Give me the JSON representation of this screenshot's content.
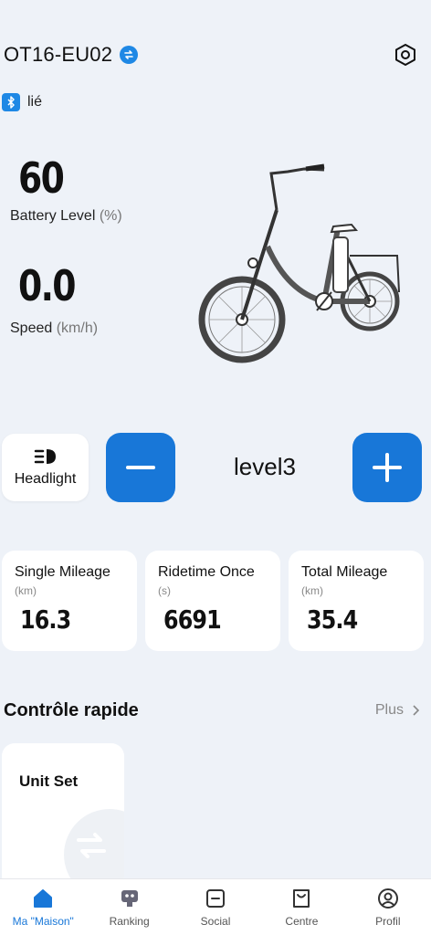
{
  "header": {
    "device_name": "OT16-EU02"
  },
  "bluetooth": {
    "status": "lié"
  },
  "battery": {
    "value": "60",
    "label": "Battery Level",
    "unit": "(%)"
  },
  "speed": {
    "value": "0.0",
    "label": "Speed",
    "unit": "(km/h)"
  },
  "controls": {
    "headlight_label": "Headlight",
    "level": "level3"
  },
  "metrics": [
    {
      "title": "Single Mileage",
      "unit": "(km)",
      "value": "16.3"
    },
    {
      "title": "Ridetime Once",
      "unit": "(s)",
      "value": "6691"
    },
    {
      "title": "Total Mileage",
      "unit": "(km)",
      "value": "35.4"
    }
  ],
  "quick": {
    "title": "Contrôle rapide",
    "more": "Plus",
    "card_title": "Unit Set"
  },
  "nav": [
    {
      "label": "Ma \"Maison\"",
      "icon": "home-icon",
      "active": true
    },
    {
      "label": "Ranking",
      "icon": "robot-icon",
      "active": false
    },
    {
      "label": "Social",
      "icon": "chat-icon",
      "active": false
    },
    {
      "label": "Centre",
      "icon": "shop-bag-icon",
      "active": false
    },
    {
      "label": "Profil",
      "icon": "user-icon",
      "active": false
    }
  ],
  "colors": {
    "accent": "#1877d8",
    "background": "#eef2f8"
  }
}
